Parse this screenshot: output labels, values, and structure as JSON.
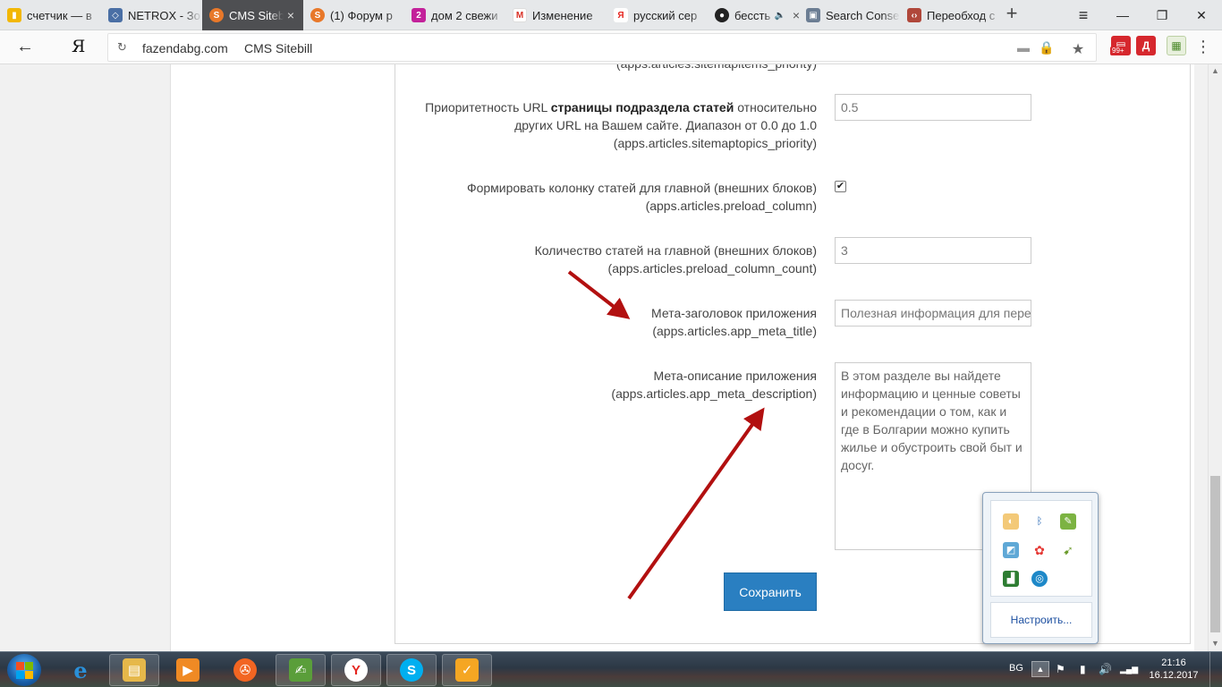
{
  "browser": {
    "tabs": [
      {
        "title": "счетчик — в",
        "icon_color": "#f2b705",
        "icon_glyph": "▮"
      },
      {
        "title": "NETROX - Зо",
        "icon_color": "#4a6fa5",
        "icon_glyph": "◇"
      },
      {
        "title": "CMS Sitebill",
        "icon_color": "#e8782a",
        "icon_glyph": "S",
        "active": true
      },
      {
        "title": "(1) Форум р",
        "icon_color": "#e8782a",
        "icon_glyph": "S"
      },
      {
        "title": "дом 2 свежи",
        "icon_color": "#c3219a",
        "icon_glyph": "2"
      },
      {
        "title": "Изменение",
        "icon_color": "#d93025",
        "icon_glyph": "M"
      },
      {
        "title": "русский сер",
        "icon_color": "#e52620",
        "icon_glyph": "Я"
      },
      {
        "title": "бессть",
        "icon_color": "#222222",
        "icon_glyph": "●",
        "audio": "🔈"
      },
      {
        "title": "Search Conse",
        "icon_color": "#6b7d93",
        "icon_glyph": "▣"
      },
      {
        "title": "Переобход с",
        "icon_color": "#b0473a",
        "icon_glyph": "‹›"
      }
    ],
    "tab_close": "×",
    "new_tab": "+",
    "window": {
      "menu": "≡",
      "minimize": "—",
      "maximize": "❐",
      "close": "✕"
    },
    "nav": {
      "back": "←",
      "yandex": "Я",
      "reload": "↻"
    },
    "address": {
      "domain": "fazendabg.com",
      "title": "CMS Sitebill"
    },
    "toolbar_icons": {
      "comment": "▬",
      "lock": "🔒",
      "star": "★"
    },
    "extensions": {
      "first": {
        "glyph": "▤",
        "color": "#d6272d",
        "badge": "99+"
      },
      "second": {
        "glyph": "Д",
        "color": "#d6272d"
      },
      "third": {
        "glyph": "▦",
        "color": "#9cc46a"
      }
    },
    "kebab": "⋮"
  },
  "form": {
    "clipped_key": "(apps.articles.sitemapitems_priority)",
    "fields": {
      "topics_priority": {
        "label_pre": "Приоритетность URL ",
        "label_bold": "страницы подраздела статей",
        "label_post": " относительно",
        "label_line2": "других URL на Вашем сайте. Диапазон от 0.0 до 1.0",
        "key": "(apps.articles.sitemaptopics_priority)",
        "value": "0.5"
      },
      "preload_column": {
        "label": "Формировать колонку статей для главной (внешних блоков)",
        "key": "(apps.articles.preload_column)",
        "checkmark": "✔"
      },
      "preload_column_count": {
        "label": "Количество статей на главной (внешних блоков)",
        "key": "(apps.articles.preload_column_count)",
        "value": "3"
      },
      "meta_title": {
        "label": "Мета-заголовок приложения",
        "key": "(apps.articles.app_meta_title)",
        "value": "Полезная информация для пере"
      },
      "meta_description": {
        "label": "Мета-описание приложения",
        "key": "(apps.articles.app_meta_description)",
        "value": "В этом разделе вы найдете информацию и ценные советы и рекомендации о том, как и где в Болгарии можно купить жилье и обустроить свой быт и досуг."
      }
    },
    "save_label": "Сохранить"
  },
  "scrollbar": {
    "up": "▲",
    "down": "▼"
  },
  "tray_flyout": {
    "icons": [
      {
        "name": "cheese-icon",
        "glyph": "◐",
        "color": "#f3c978"
      },
      {
        "name": "bluetooth-icon",
        "glyph": "ᛒ",
        "color": "#1b5fb0"
      },
      {
        "name": "evernote-icon",
        "glyph": "✎",
        "color": "#7cb342"
      },
      {
        "name": "recorder-icon",
        "glyph": "◩",
        "color": "#5fa8d6"
      },
      {
        "name": "flower-icon",
        "glyph": "✿",
        "color": "#e53935"
      },
      {
        "name": "hummingbird-icon",
        "glyph": "➹",
        "color": "#6a9a2a"
      },
      {
        "name": "puzzle-icon",
        "glyph": "▟",
        "color": "#2e7d32"
      },
      {
        "name": "network-icon",
        "glyph": "◎",
        "color": "#1e88c8"
      }
    ],
    "configure_label": "Настроить..."
  },
  "taskbar": {
    "items": [
      {
        "name": "ie-icon",
        "glyph": "e",
        "color": "#2a8fd8"
      },
      {
        "name": "explorer-icon",
        "glyph": "▤",
        "color": "#e6b84a"
      },
      {
        "name": "media-icon",
        "glyph": "▶",
        "color": "#f08a24"
      },
      {
        "name": "film-reel-icon",
        "glyph": "✇",
        "color": "#f26522"
      },
      {
        "name": "notepad-icon",
        "glyph": "✍",
        "color": "#5a9e3a"
      },
      {
        "name": "yandex-browser-icon",
        "glyph": "Y",
        "color": "#e52620"
      },
      {
        "name": "skype-icon",
        "glyph": "S",
        "color": "#00aff0"
      },
      {
        "name": "task-icon",
        "glyph": "✓",
        "color": "#f5a623"
      }
    ],
    "lang": "BG",
    "tray_arrow": "▲",
    "tray_icons": {
      "flag": "⚑",
      "battery": "▮",
      "volume": "🔊",
      "signal": "▂▄▆"
    },
    "time": "21:16",
    "date": "16.12.2017"
  }
}
